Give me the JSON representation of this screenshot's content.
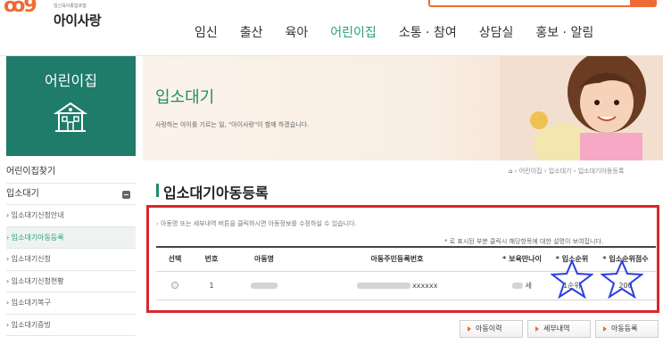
{
  "logo": {
    "tagline": "임신육아종합포털",
    "name": "아이사랑"
  },
  "gnb": [
    {
      "label": "임신"
    },
    {
      "label": "출산"
    },
    {
      "label": "육아"
    },
    {
      "label": "어린이집"
    },
    {
      "label": "소통 · 참여"
    },
    {
      "label": "상담실"
    },
    {
      "label": "홍보 · 알림"
    }
  ],
  "sidebar": {
    "title": "어린이집",
    "items": [
      {
        "label": "어린이집찾기",
        "type": "section"
      },
      {
        "label": "입소대기",
        "type": "section"
      },
      {
        "label": "› 입소대기신청안내",
        "type": "sub"
      },
      {
        "label": "› 입소대기아동등록",
        "type": "sub",
        "active": true
      },
      {
        "label": "› 입소대기신청",
        "type": "sub"
      },
      {
        "label": "› 입소대기신청현황",
        "type": "sub"
      },
      {
        "label": "› 입소대기복구",
        "type": "sub"
      },
      {
        "label": "› 입소대기증빙",
        "type": "sub"
      }
    ]
  },
  "banner": {
    "title": "입소대기",
    "subtitle": "사랑하는 아이를 기르는 일, \"아이사랑\"이 함께 하겠습니다."
  },
  "breadcrumb": [
    "어린이집",
    "입소대기",
    "입소대기아동등록"
  ],
  "page_title": "입소대기아동등록",
  "notice": "아동명 또는 세부내역 버튼을 클릭하시면 아동정보를 수정하실 수 있습니다.",
  "hint": "* 로 표시된 부분 클릭시 해당항목에 대한 설명이 보여집니다.",
  "table": {
    "headers": [
      "선택",
      "번호",
      "아동명",
      "아동주민등록번호",
      "* 보육만나이",
      "* 입소순위",
      "* 입소순위점수"
    ],
    "rows": [
      {
        "number": "1",
        "id_suffix": "xxxxxx",
        "age_suffix": "세",
        "rank": "1순위",
        "score": "200"
      }
    ]
  },
  "buttons": {
    "history": "아동이력",
    "detail": "세부내역",
    "register": "아동등록"
  },
  "colors": {
    "brand_orange": "#ef6a33",
    "brand_green": "#1f7b6a",
    "highlight_red": "#d9262b",
    "annotation_blue": "#2d3fe0"
  }
}
